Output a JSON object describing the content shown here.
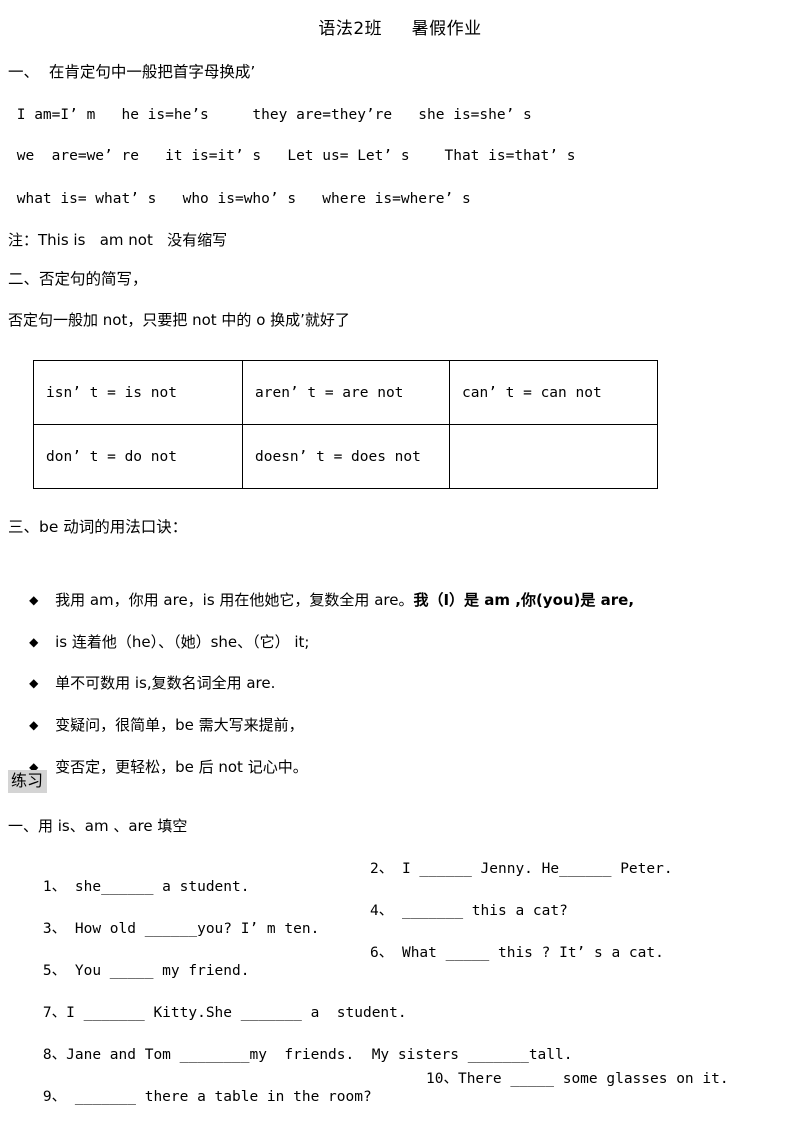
{
  "document": {
    "title": "语法2班     暑假作业",
    "section1": {
      "heading": "一、  在肯定句中一般把首字母换成’",
      "lines": [
        " I am=I’ m   he is=he’s     they are=they’re   she is=she’ s",
        " we  are=we’ re   it is=it’ s   Let us= Let’ s    That is=that’ s",
        " what is= what’ s   who is=who’ s   where is=where’ s"
      ],
      "note": "注：This is   am not   没有缩写"
    },
    "section2": {
      "heading": "二、否定句的简写，",
      "rule": "否定句一般加 not，只要把 not 中的 o 换成’就好了",
      "table": [
        [
          "isn’ t = is not",
          "aren’ t = are not",
          "can’ t = can not"
        ],
        [
          "don’ t = do not",
          "doesn’ t = does not",
          ""
        ]
      ]
    },
    "section3": {
      "heading": "三、be 动词的用法口诀：",
      "bullet_glyph": "◆",
      "bullets": [
        {
          "plain": "我用 am，你用 are，is 用在他她它，复数全用 are。",
          "bold": "我（I）是 am ,你(you)是 are,"
        },
        {
          "plain": "is 连着他（he）、（她）she、（它） it;",
          "bold": ""
        },
        {
          "plain": "单不可数用 is,复数名词全用 are.",
          "bold": ""
        },
        {
          "plain": "变疑问，很简单，be 需大写来提前，",
          "bold": ""
        },
        {
          "plain": "变否定，更轻松，be 后 not 记心中。",
          "bold": ""
        }
      ]
    },
    "practice": {
      "label": "练习",
      "instruction": "一、用 is、am 、are 填空",
      "questions": [
        {
          "left": "1、 she______ a student.",
          "right": "2、 I ______ Jenny. He______ Peter."
        },
        {
          "left": "3、 How old ______you? I’ m ten.",
          "right": "4、 _______ this a cat?"
        },
        {
          "left": "5、 You _____ my friend.",
          "right": "6、 What _____ this ? It’ s a cat."
        },
        {
          "left": "7、I _______ Kitty.She _______ a  student.",
          "right": ""
        },
        {
          "left": "8、Jane and Tom ________my  friends.  My sisters _______tall.",
          "right": ""
        },
        {
          "left": "9、 _______ there a table in the room?",
          "right": "10、There _____ some glasses on it."
        }
      ]
    }
  }
}
